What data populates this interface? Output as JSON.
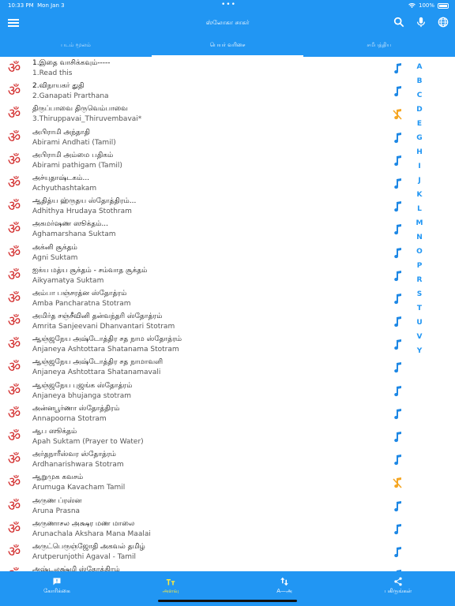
{
  "status": {
    "time": "10:33 PM",
    "date": "Mon Jan 3",
    "battery": "100%"
  },
  "appbar": {
    "title": "ஸ்லோகா சாகர்"
  },
  "tabs": [
    {
      "label": "படம் மூலம்"
    },
    {
      "label": "பெயர் வரிசை"
    },
    {
      "label": "சமீபத்திய"
    }
  ],
  "list": [
    {
      "t1": "1.இதை வாசிக்கவும்-----",
      "t2": "1.Read this",
      "audio": true
    },
    {
      "t1": "2.விநாயகர் துதி",
      "t2": "2.Ganapati Prarthana",
      "audio": true
    },
    {
      "t1": "திருப்பாவை திருவெம்பாவை",
      "t2": "3.Thiruppavai_Thiruvembavai*",
      "audio": false
    },
    {
      "t1": "அபிராமி அந்தாதி",
      "t2": "Abirami Andhati (Tamil)",
      "audio": true
    },
    {
      "t1": "அபிராமி அம்மை பதிகம்",
      "t2": "Abirami pathigam (Tamil)",
      "audio": true
    },
    {
      "t1": "அச்யுதாஷ்டகம்...",
      "t2": "Achyuthashtakam",
      "audio": true
    },
    {
      "t1": "ஆதித்ய ஹ்ருதய ஸ்தோத்திரம்...",
      "t2": "Adhithya Hrudaya Stothram",
      "audio": true
    },
    {
      "t1": "அகமர்ஷண ஸூக்தம்...",
      "t2": "Aghamarshana Suktam",
      "audio": true
    },
    {
      "t1": "அக்னி சூக்தம்",
      "t2": "Agni Suktam",
      "audio": true
    },
    {
      "t1": "ஐக்ய மத்ய சூக்தம் - சம்வாத சூக்தம்",
      "t2": "Aikyamatya Suktam",
      "audio": true
    },
    {
      "t1": "அம்பா பஞ்சரத்ன ஸ்தோத்ரம்",
      "t2": "Amba Pancharatna Stotram",
      "audio": true
    },
    {
      "t1": "அமிர்த சஞ்சீவினி தன்வந்தரி ஸ்தோத்ரம்",
      "t2": "Amrita Sanjeevani Dhanvantari Stotram",
      "audio": true
    },
    {
      "t1": "ஆஞ்ஜநேய அஷ்டோத்திர சத நாம ஸ்தோத்ரம்",
      "t2": "Anjaneya Ashtottara Shatanama Stotram",
      "audio": true
    },
    {
      "t1": "ஆஞ்ஜநேய அஷ்டோத்திர சத நாமாவளி",
      "t2": "Anjaneya Ashtottara Shatanamavali",
      "audio": true
    },
    {
      "t1": "ஆஞ்ஜநேய புஜங்க ஸ்தோத்ரம்",
      "t2": "Anjaneya bhujanga stotram",
      "audio": true
    },
    {
      "t1": "அன்னபூர்ணா ஸ்தோத்திரம்",
      "t2": "Annapoorna Stotram",
      "audio": true
    },
    {
      "t1": "ஆப ஸூக்தம்",
      "t2": "Apah  Suktam (Prayer to Water)",
      "audio": true
    },
    {
      "t1": "அர்தநாரீஸ்வர ஸ்தோத்ரம்",
      "t2": "Ardhanarishwara Stotram",
      "audio": true
    },
    {
      "t1": "ஆறுமுக கவசம்",
      "t2": "Arumuga Kavacham Tamil",
      "audio": false
    },
    {
      "t1": "அருண ப்ரஸ்ன",
      "t2": "Aruna Prasna",
      "audio": true
    },
    {
      "t1": "அருணாசல அக்ஷர மண மாலை",
      "t2": "Arunachala Akshara Mana Maalai",
      "audio": true
    },
    {
      "t1": "அருட்பெருஞ்ஜோதி அகவல்   தமிழ்",
      "t2": "Arutperunjothi Agaval - Tamil",
      "audio": true
    },
    {
      "t1": "அஷ்டலக்ஷ்மி ஸ்தோத்திரம்",
      "t2": "",
      "audio": true
    }
  ],
  "alphabet": [
    "A",
    "B",
    "C",
    "D",
    "E",
    "G",
    "H",
    "I",
    "J",
    "K",
    "L",
    "M",
    "N",
    "O",
    "P",
    "R",
    "S",
    "T",
    "U",
    "V",
    "Y"
  ],
  "bottom": [
    {
      "label": "கோரிக்கை"
    },
    {
      "label": "அளவு"
    },
    {
      "label": "A—அ"
    },
    {
      "label": "பகிருங்கள்"
    }
  ],
  "colors": {
    "primary": "#2196f3",
    "om": "#d32f2f",
    "audio_on": "#1e88e5",
    "audio_off": "#f5a623",
    "active_tab": "#ffeb3b"
  }
}
